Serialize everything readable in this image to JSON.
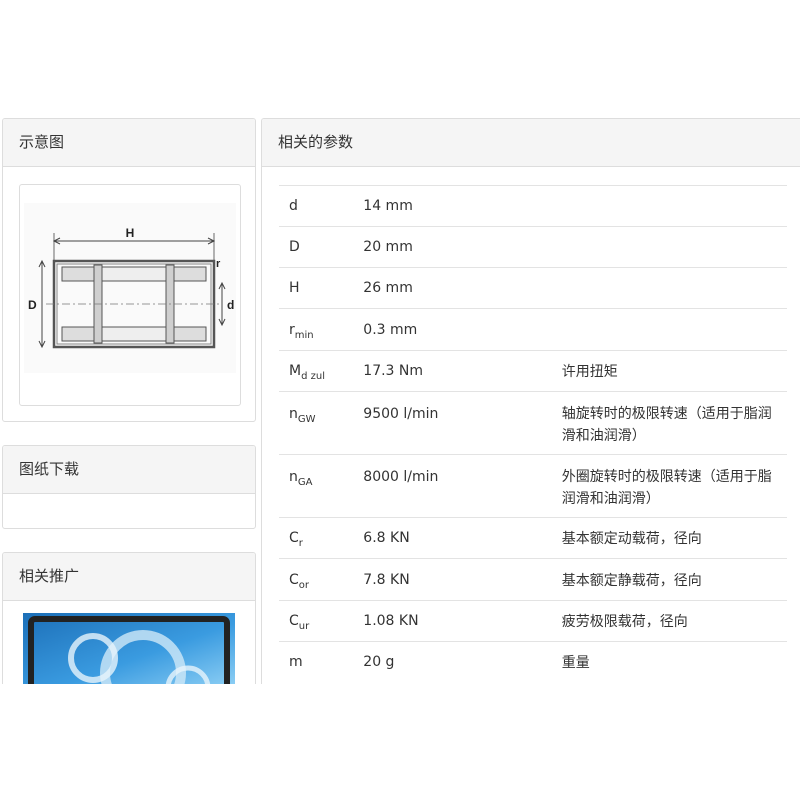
{
  "diagram_panel": {
    "title": "示意图",
    "labels": {
      "H": "H",
      "r": "r",
      "D": "D",
      "d": "d"
    }
  },
  "download_panel": {
    "title": "图纸下载"
  },
  "promo_panel": {
    "title": "相关推广"
  },
  "params_panel": {
    "title": "相关的参数",
    "rows": [
      {
        "sym": "d",
        "sub": "",
        "value": "14 mm",
        "desc": ""
      },
      {
        "sym": "D",
        "sub": "",
        "value": "20 mm",
        "desc": ""
      },
      {
        "sym": "H",
        "sub": "",
        "value": "26 mm",
        "desc": ""
      },
      {
        "sym": "r",
        "sub": "min",
        "value": "0.3 mm",
        "desc": ""
      },
      {
        "sym": "M",
        "sub": "d zul",
        "value": "17.3 Nm",
        "desc": "许用扭矩"
      },
      {
        "sym": "n",
        "sub": "GW",
        "value": "9500 l/min",
        "desc": "轴旋转时的极限转速（适用于脂润滑和油润滑）"
      },
      {
        "sym": "n",
        "sub": "GA",
        "value": "8000 l/min",
        "desc": "外圈旋转时的极限转速（适用于脂润滑和油润滑）"
      },
      {
        "sym": "C",
        "sub": "r",
        "value": "6.8 KN",
        "desc": "基本额定动载荷，径向"
      },
      {
        "sym": "C",
        "sub": "or",
        "value": "7.8 KN",
        "desc": "基本额定静载荷，径向"
      },
      {
        "sym": "C",
        "sub": "ur",
        "value": "1.08 KN",
        "desc": "疲劳极限载荷，径向"
      },
      {
        "sym": "m",
        "sub": "",
        "value": "20 g",
        "desc": "重量"
      }
    ]
  }
}
